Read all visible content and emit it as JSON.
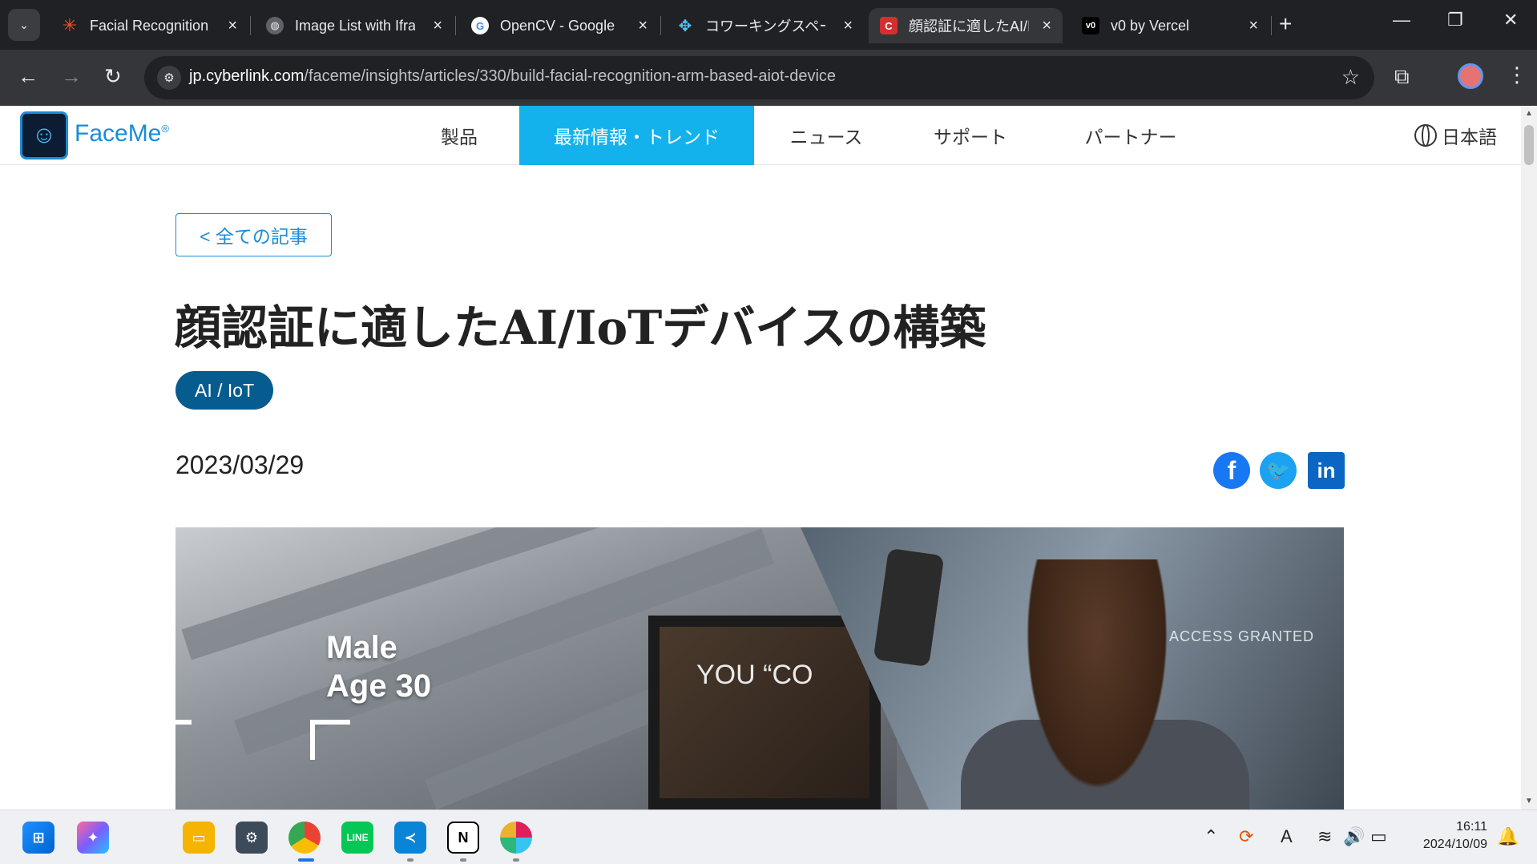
{
  "browser": {
    "tabs": [
      {
        "label": "Facial Recognition",
        "icon": "asterisk-icon",
        "color": "#f4511e"
      },
      {
        "label": "Image List with Ifra",
        "icon": "globe-icon",
        "color": "#9aa0a6"
      },
      {
        "label": "OpenCV - Google",
        "icon": "google-icon",
        "color": "#ffffff"
      },
      {
        "label": "コワーキングスペースの",
        "icon": "puzzle-icon",
        "color": "#4fc3f7"
      },
      {
        "label": "顔認証に適したAI/Io",
        "icon": "cyberlink-icon",
        "color": "#d32f2f"
      },
      {
        "label": "v0 by Vercel",
        "icon": "v0-icon",
        "color": "#000000"
      }
    ],
    "url_domain": "jp.cyberlink.com",
    "url_path": "/faceme/insights/articles/330/build-facial-recognition-arm-based-aiot-device"
  },
  "site": {
    "logo_text": "FaceMe",
    "logo_mark": "®",
    "nav": [
      {
        "label": "製品"
      },
      {
        "label": "最新情報・トレンド"
      },
      {
        "label": "ニュース"
      },
      {
        "label": "サポート"
      },
      {
        "label": "パートナー"
      }
    ],
    "language": "日本語"
  },
  "article": {
    "back_label": "< 全ての記事",
    "title": "顔認証に適したAI/IoTデバイスの構築",
    "tag": "AI / IoT",
    "date": "2023/03/29",
    "hero": {
      "overlay_line1": "Male",
      "overlay_line2": "Age 30",
      "access_text": "ACCESS GRANTED",
      "cafe_text": "YOU “CO"
    }
  },
  "taskbar": {
    "clock_time": "16:11",
    "clock_date": "2024/10/09",
    "ime": "A"
  },
  "colors": {
    "accent": "#13b2ec",
    "brand": "#1a8cd8",
    "tag_bg": "#075c8f"
  }
}
